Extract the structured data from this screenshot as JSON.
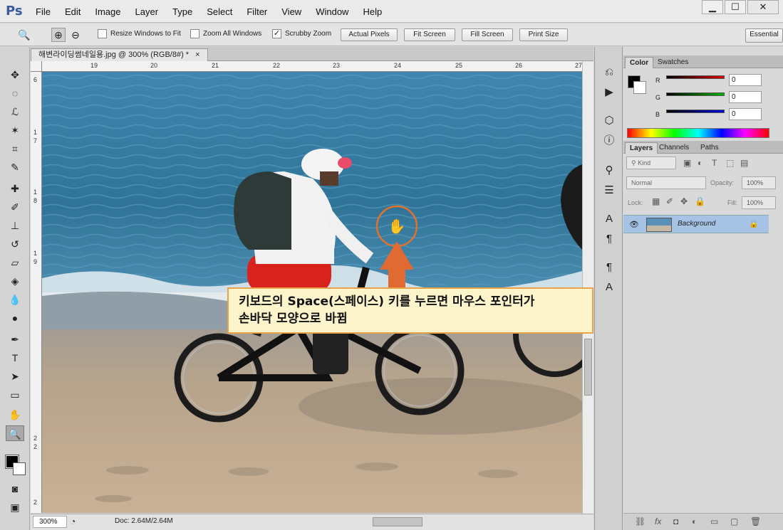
{
  "app": {
    "logo": "Ps",
    "menu": [
      "File",
      "Edit",
      "Image",
      "Layer",
      "Type",
      "Select",
      "Filter",
      "View",
      "Window",
      "Help"
    ],
    "window_controls": [
      "▁",
      "☐",
      "✕"
    ]
  },
  "options": {
    "resize_windows": "Resize Windows to Fit",
    "zoom_all": "Zoom All Windows",
    "scrubby_zoom": "Scrubby Zoom",
    "actual_pixels": "Actual Pixels",
    "fit_screen": "Fit Screen",
    "fill_screen": "Fill Screen",
    "print_size": "Print Size",
    "workspace": "Essential",
    "scrubby_checked": "✓"
  },
  "document": {
    "tab_title": "해변라이딩썸네일용.jpg @ 300% (RGB/8#) *",
    "tab_close": "×",
    "ruler_top": [
      "19",
      "20",
      "21",
      "22",
      "23",
      "24",
      "25",
      "26",
      "27"
    ],
    "ruler_left": [
      "6",
      "1",
      "7",
      "1",
      "8",
      "1",
      "9",
      "2",
      "2",
      "2"
    ],
    "zoom": "300%",
    "doc_size": "Doc: 2.64M/2.64M"
  },
  "callout": {
    "line1": "키보드의 Space(스페이스) 키를 누르면 마우스 포인터가",
    "line2": "손바닥 모양으로 바뀜"
  },
  "color_panel": {
    "tabs": [
      "Color",
      "Swatches"
    ],
    "channels": [
      {
        "label": "R",
        "value": "0",
        "color": "#e00000"
      },
      {
        "label": "G",
        "value": "0",
        "color": "#00b000"
      },
      {
        "label": "B",
        "value": "0",
        "color": "#0000e0"
      }
    ]
  },
  "layers_panel": {
    "tabs": [
      "Layers",
      "Channels",
      "Paths"
    ],
    "kind": "Kind",
    "blend": "Normal",
    "opacity_label": "Opacity:",
    "opacity": "100%",
    "lock_label": "Lock:",
    "fill_label": "Fill:",
    "fill": "100%",
    "layer_name": "Background"
  }
}
